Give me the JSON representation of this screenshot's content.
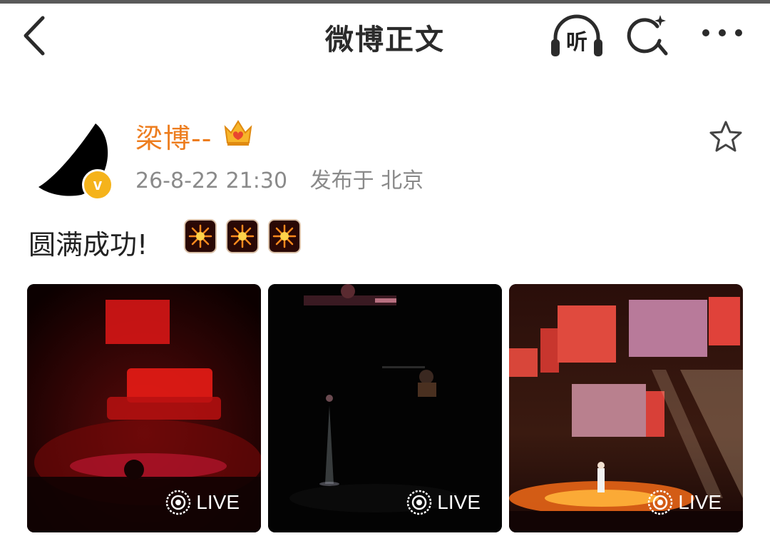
{
  "nav": {
    "title": "微博正文",
    "listen_label": "听"
  },
  "post": {
    "author": "梁博--",
    "timestamp": "26-8-22 21:30",
    "source": "发布于 北京",
    "verified_badge": "v",
    "text": "圆满成功!",
    "emoji_icons": [
      "firework-icon",
      "firework-icon",
      "firework-icon"
    ],
    "photos": [
      {
        "live_label": "LIVE"
      },
      {
        "live_label": "LIVE"
      },
      {
        "live_label": "LIVE"
      }
    ]
  },
  "colors": {
    "author": "#ed7d1e",
    "meta": "#8a8a8a",
    "verified": "#f5b31b"
  }
}
